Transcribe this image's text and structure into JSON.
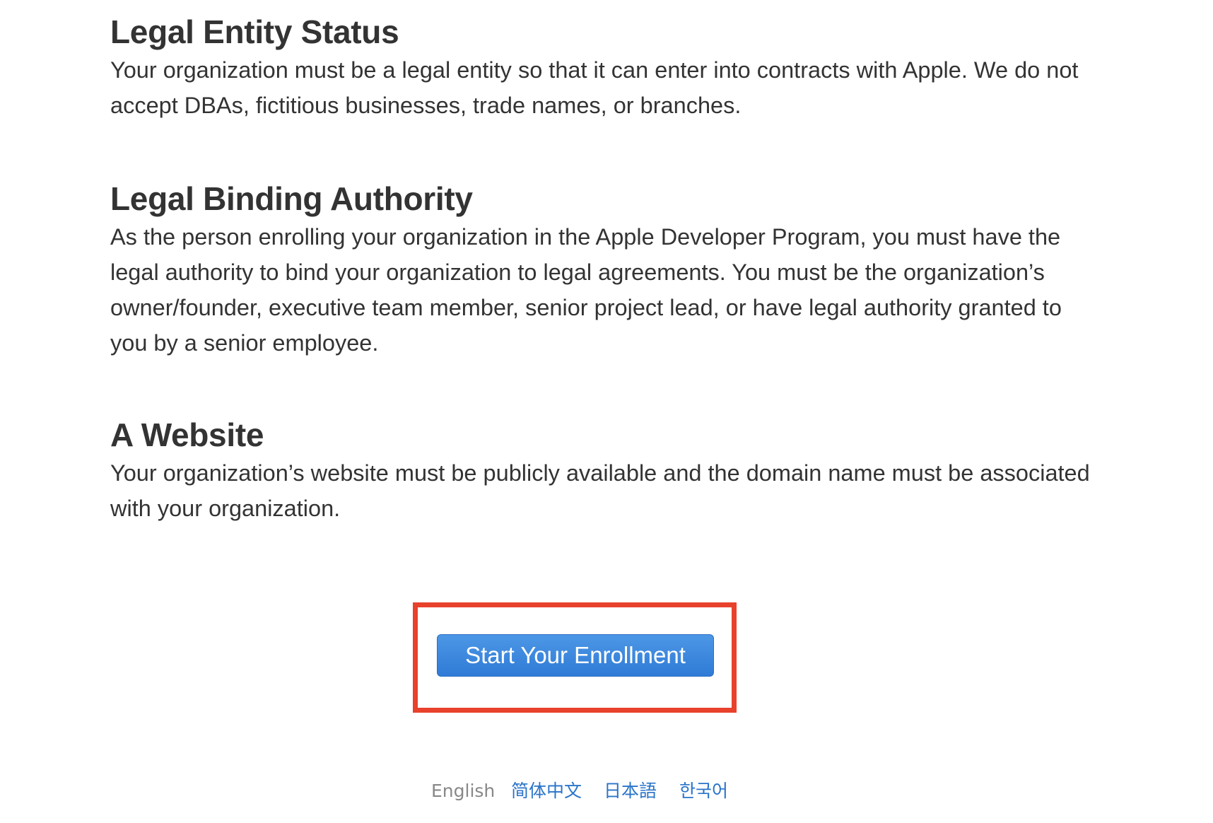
{
  "sections": [
    {
      "heading": "Legal Entity Status",
      "lines": [
        "Your organization must be a legal entity so that it can enter into contracts with Apple. We do not",
        "accept DBAs, fictitious businesses, trade names, or branches."
      ]
    },
    {
      "heading": "Legal Binding Authority",
      "lines": [
        "As the person enrolling your organization in the Apple Developer Program, you must have the",
        "legal authority to bind your organization to legal agreements. You must be the organization’s",
        "owner/founder, executive team member, senior project lead, or have legal authority granted to",
        "you by a senior employee."
      ]
    },
    {
      "heading": "A Website",
      "lines": [
        "Your organization’s website must be publicly available and the domain name must be associated",
        "with your organization."
      ]
    }
  ],
  "enroll_button": {
    "label": "Start Your Enrollment"
  },
  "languages": [
    {
      "label": "English",
      "current": true
    },
    {
      "label": "简体中文",
      "current": false
    },
    {
      "label": "日本語",
      "current": false
    },
    {
      "label": "한국어",
      "current": false
    }
  ],
  "colors": {
    "highlight": "#e8412c",
    "button": "#2f7bd6",
    "link": "#2a74c9"
  }
}
